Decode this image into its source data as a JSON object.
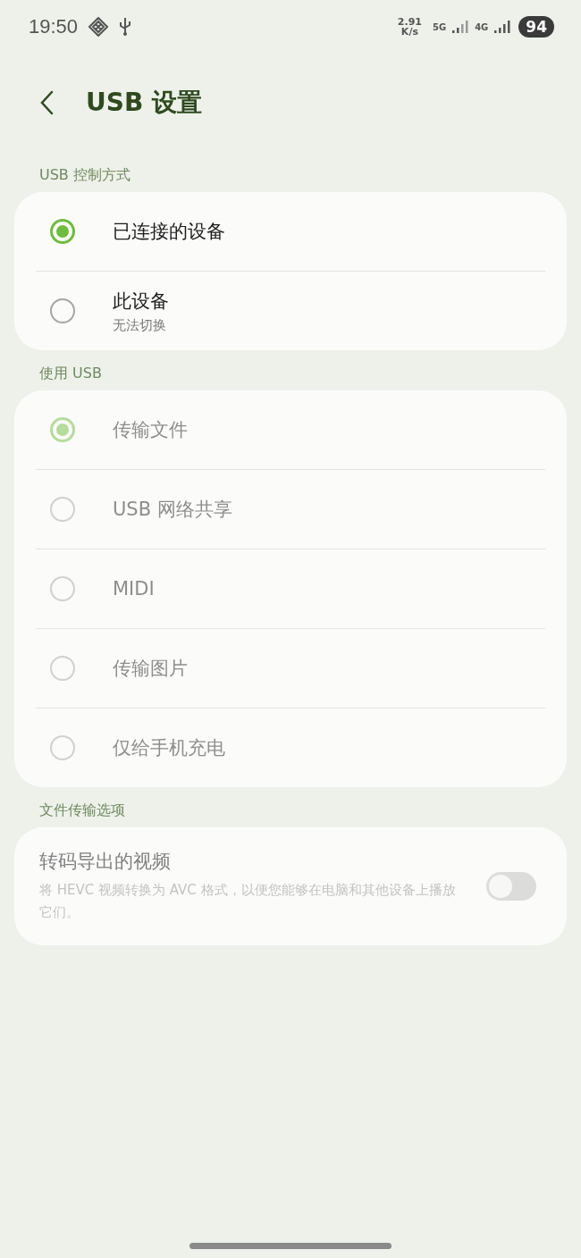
{
  "status_bar": {
    "time": "19:50",
    "speed_value": "2.91",
    "speed_unit": "K/s",
    "network_1": "5G",
    "network_2": "4G",
    "battery": "94"
  },
  "header": {
    "title": "USB 设置"
  },
  "sections": [
    {
      "label": "USB 控制方式",
      "disabled": false,
      "options": [
        {
          "label": "已连接的设备",
          "selected": true
        },
        {
          "label": "此设备",
          "sublabel": "无法切换",
          "selected": false
        }
      ]
    },
    {
      "label": "使用 USB",
      "disabled": true,
      "options": [
        {
          "label": "传输文件",
          "selected": true
        },
        {
          "label": "USB 网络共享",
          "selected": false
        },
        {
          "label": "MIDI",
          "selected": false
        },
        {
          "label": "传输图片",
          "selected": false
        },
        {
          "label": "仅给手机充电",
          "selected": false
        }
      ]
    }
  ],
  "file_transfer": {
    "label": "文件传输选项",
    "title": "转码导出的视频",
    "description": "将 HEVC 视频转换为 AVC 格式，以便您能够在电脑和其他设备上播放它们。",
    "on": false,
    "disabled": true
  }
}
